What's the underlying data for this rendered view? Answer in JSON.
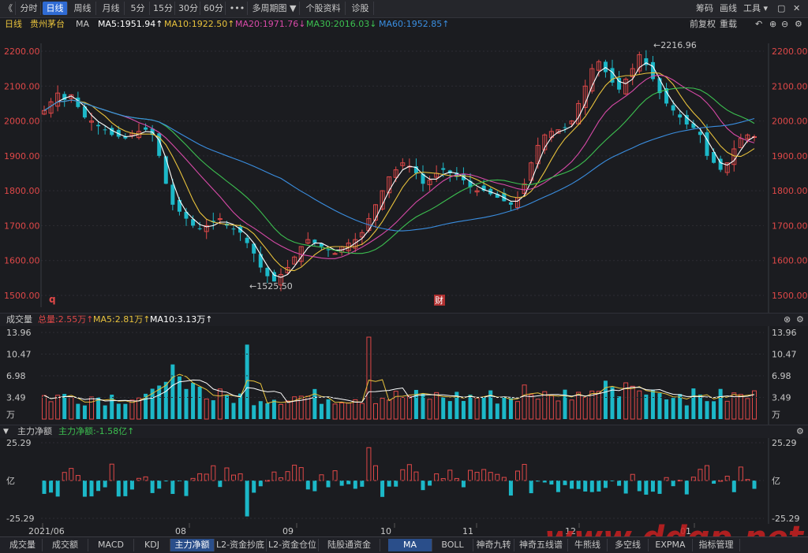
{
  "toolbar": {
    "back": "《",
    "items": [
      "分时",
      "日线",
      "周线",
      "月线",
      "5分",
      "15分",
      "30分",
      "60分",
      "•••",
      "多周期图 ▼",
      "个股资料",
      "诊股"
    ],
    "active_index": 1,
    "right": [
      "筹码",
      "画线",
      "工具 ▾"
    ],
    "win_minimize": "▢",
    "win_close": "✕"
  },
  "info": {
    "period": "日线",
    "stock": "贵州茅台",
    "ma_label": "MA",
    "ma5": "MA5:1951.94↑",
    "ma10": "MA10:1922.50↑",
    "ma20": "MA20:1971.76↓",
    "ma30": "MA30:2016.03↓",
    "ma60": "MA60:1952.85↑",
    "restore": "前复权",
    "overlay": "重载"
  },
  "colors": {
    "up": "#e04848",
    "down": "#1cb8c8",
    "ma5": "#ffffff",
    "ma10": "#e8c23c",
    "ma20": "#d84aa8",
    "ma30": "#3cc050",
    "ma60": "#3a8ee0",
    "bg": "#1b1c20"
  },
  "price_axis": [
    "2200.00",
    "2100.00",
    "2000.00",
    "1900.00",
    "1800.00",
    "1700.00",
    "1600.00",
    "1500.00"
  ],
  "annotations": {
    "high": "←2216.96",
    "low": "←1525.50",
    "marker_q": "q",
    "marker_cai": "财"
  },
  "volume": {
    "title": "成交量",
    "total": "总量:2.55万↑",
    "ma5": "MA5:2.81万↑",
    "ma10": "MA10:3.13万↑",
    "axis": [
      "13.96",
      "10.47",
      "6.98",
      "3.49",
      "万"
    ]
  },
  "flow": {
    "title": "主力净额",
    "value": "主力净额:-1.58亿↑",
    "axis": [
      "25.29",
      "亿",
      "-25.29"
    ]
  },
  "dates": [
    "2021/06",
    "08",
    "09",
    "10",
    "11",
    "12",
    "01"
  ],
  "tabs": [
    "成交量",
    "成交额",
    "MACD",
    "KDJ",
    "主力净额",
    "L2-资金抄底",
    "L2-资金仓位",
    "陆股通资金",
    "MA",
    "BOLL",
    "神奇九转",
    "神奇五线谱",
    "牛熊线",
    "多空线",
    "EXPMA",
    "指标管理"
  ],
  "active_tabs": [
    4,
    8
  ],
  "watermark": "www.ddgp.net",
  "chart_data": {
    "type": "candlestick",
    "title": "贵州茅台 日线",
    "ylim": [
      1480,
      2240
    ],
    "close_path": [
      2030,
      2055,
      2080,
      2060,
      2075,
      2040,
      2010,
      2000,
      1985,
      1975,
      1960,
      1955,
      1950,
      1965,
      1970,
      1975,
      1960,
      1900,
      1820,
      1760,
      1740,
      1720,
      1700,
      1690,
      1700,
      1710,
      1720,
      1700,
      1690,
      1680,
      1650,
      1620,
      1580,
      1555,
      1540,
      1560,
      1580,
      1610,
      1640,
      1660,
      1650,
      1640,
      1630,
      1620,
      1640,
      1650,
      1660,
      1680,
      1720,
      1760,
      1800,
      1840,
      1860,
      1880,
      1870,
      1850,
      1820,
      1830,
      1850,
      1860,
      1850,
      1840,
      1830,
      1810,
      1800,
      1800,
      1790,
      1780,
      1770,
      1760,
      1780,
      1820,
      1880,
      1930,
      1960,
      1970,
      1975,
      1980,
      2000,
      2050,
      2100,
      2150,
      2170,
      2140,
      2110,
      2090,
      2120,
      2150,
      2190,
      2160,
      2120,
      2080,
      2050,
      2030,
      2010,
      1990,
      1980,
      1960,
      1900,
      1880,
      1860,
      1880,
      1920,
      1950,
      1960,
      1955
    ],
    "volume_scale_max": 13.96,
    "flow_range": [
      -25.29,
      25.29
    ]
  }
}
